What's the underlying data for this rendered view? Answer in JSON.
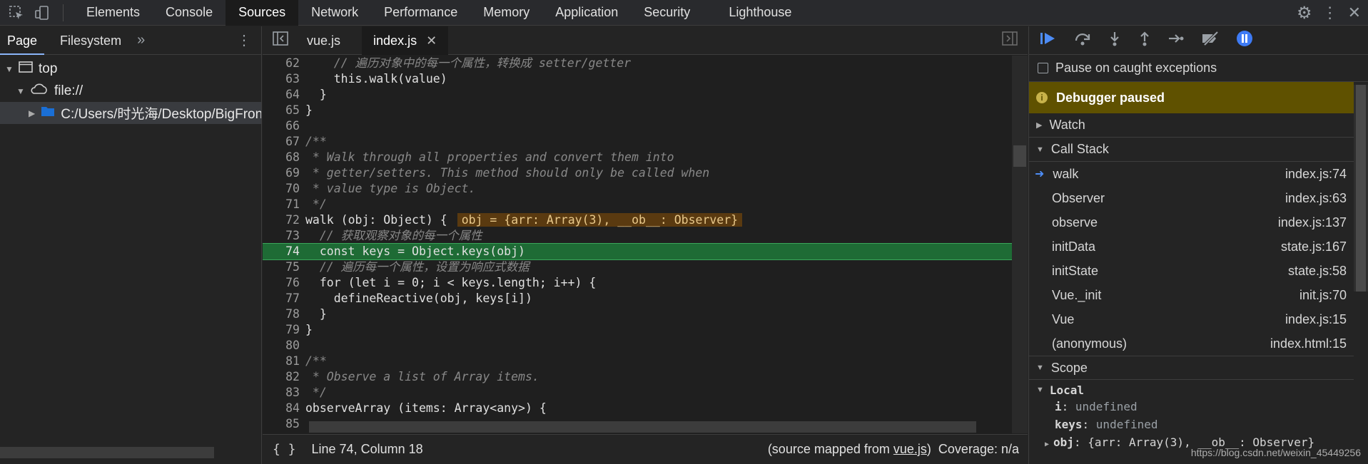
{
  "top_tabs": [
    "Elements",
    "Console",
    "Sources",
    "Network",
    "Performance",
    "Memory",
    "Application",
    "Security",
    "Lighthouse"
  ],
  "left": {
    "tabs": [
      "Page",
      "Filesystem"
    ],
    "tree": {
      "top": "top",
      "file": "file://",
      "folder": "C:/Users/时光海/Desktop/BigFron"
    }
  },
  "editor": {
    "tabs": [
      "vue.js",
      "index.js"
    ],
    "lines": [
      {
        "n": "62",
        "text": "    // 遍历对象中的每一个属性，转换成 setter/getter"
      },
      {
        "n": "63",
        "text": "    this.walk(value)"
      },
      {
        "n": "64",
        "text": "  }"
      },
      {
        "n": "65",
        "text": "}"
      },
      {
        "n": "66",
        "text": ""
      },
      {
        "n": "67",
        "text": "/**"
      },
      {
        "n": "68",
        "text": " * Walk through all properties and convert them into"
      },
      {
        "n": "69",
        "text": " * getter/setters. This method should only be called when"
      },
      {
        "n": "70",
        "text": " * value type is Object."
      },
      {
        "n": "71",
        "text": " */"
      },
      {
        "n": "72",
        "text": "walk (obj: Object) {"
      },
      {
        "n": "73",
        "text": "  // 获取观察对象的每一个属性"
      },
      {
        "n": "74",
        "text": "  const keys = Object.keys(obj)"
      },
      {
        "n": "75",
        "text": "  // 遍历每一个属性，设置为响应式数据"
      },
      {
        "n": "76",
        "text": "  for (let i = 0; i < keys.length; i++) {"
      },
      {
        "n": "77",
        "text": "    defineReactive(obj, keys[i])"
      },
      {
        "n": "78",
        "text": "  }"
      },
      {
        "n": "79",
        "text": "}"
      },
      {
        "n": "80",
        "text": ""
      },
      {
        "n": "81",
        "text": "/**"
      },
      {
        "n": "82",
        "text": " * Observe a list of Array items."
      },
      {
        "n": "83",
        "text": " */"
      },
      {
        "n": "84",
        "text": "observeArray (items: Array<any>) {"
      },
      {
        "n": "85",
        "text": ""
      }
    ],
    "inline_value": "obj = {arr: Array(3), __ob__: Observer}",
    "status": {
      "position": "Line 74, Column 18",
      "mapped_prefix": "(source mapped from ",
      "mapped_file": "vue.js",
      "mapped_suffix": ")",
      "coverage": "Coverage: n/a"
    }
  },
  "debugger": {
    "pause_exceptions": "Pause on caught exceptions",
    "paused_label": "Debugger paused",
    "watch": "Watch",
    "call_stack": "Call Stack",
    "frames": [
      {
        "name": "walk",
        "loc": "index.js:74"
      },
      {
        "name": "Observer",
        "loc": "index.js:63"
      },
      {
        "name": "observe",
        "loc": "index.js:137"
      },
      {
        "name": "initData",
        "loc": "state.js:167"
      },
      {
        "name": "initState",
        "loc": "state.js:58"
      },
      {
        "name": "Vue._init",
        "loc": "init.js:70"
      },
      {
        "name": "Vue",
        "loc": "index.js:15"
      },
      {
        "name": "(anonymous)",
        "loc": "index.html:15"
      }
    ],
    "scope": "Scope",
    "local": "Local",
    "scope_vars": [
      {
        "name": "i",
        "value": "undefined"
      },
      {
        "name": "keys",
        "value": "undefined"
      },
      {
        "name": "obj",
        "value": "{arr: Array(3), __ob__: Observer}"
      }
    ]
  },
  "watermark": "https://blog.csdn.net/weixin_45449256"
}
